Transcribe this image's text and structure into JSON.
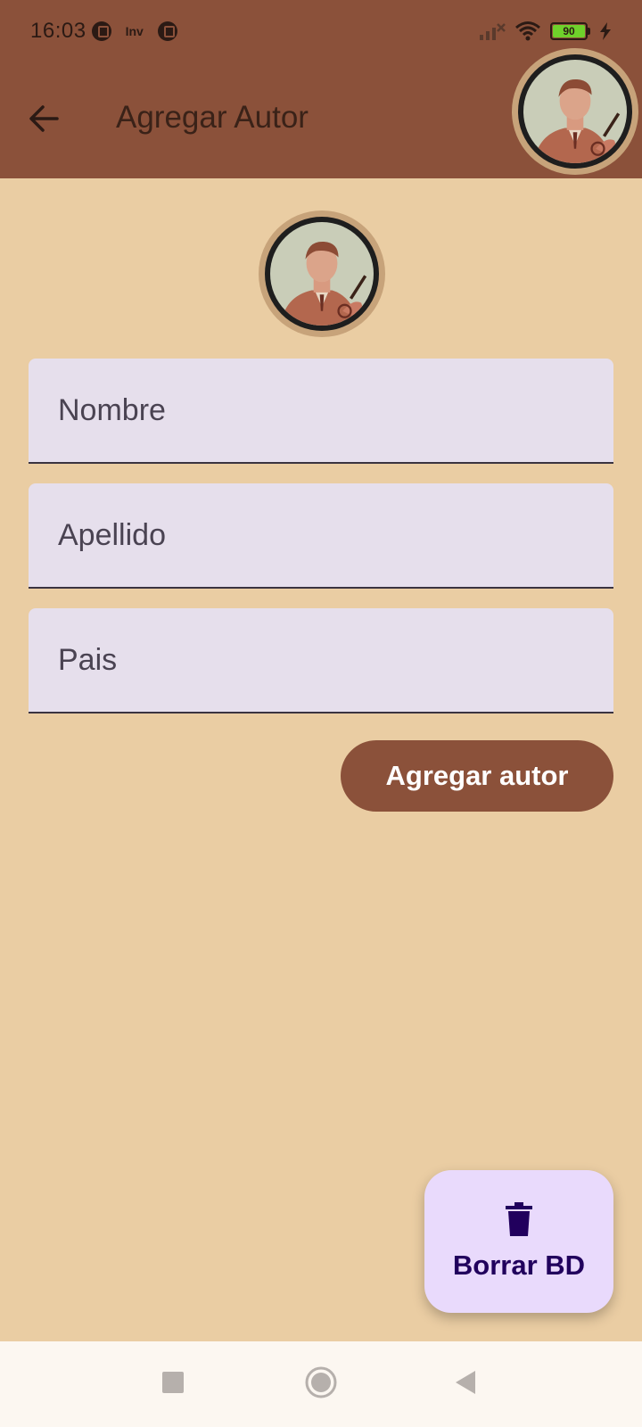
{
  "status_bar": {
    "time": "16:03",
    "app_text": "Inv",
    "battery_level": "90",
    "icons": [
      "app-notification-icon",
      "signal-icon",
      "wifi-icon",
      "battery-icon",
      "charging-bolt-icon"
    ]
  },
  "app_bar": {
    "title": "Agregar Autor",
    "back_icon": "arrow-back-icon",
    "avatar": "author-portrait-avatar"
  },
  "form": {
    "avatar": "author-portrait-avatar",
    "fields": {
      "nombre_placeholder": "Nombre",
      "apellido_placeholder": "Apellido",
      "pais_placeholder": "Pais"
    },
    "submit_label": "Agregar autor"
  },
  "fab": {
    "icon": "trash-icon",
    "label": "Borrar BD"
  },
  "nav_bar": {
    "icons": [
      "recent-apps-icon",
      "home-icon",
      "back-triangle-icon"
    ]
  },
  "colors": {
    "app_bar": "#8b513a",
    "background": "#eacda3",
    "field_background": "#e6dfec",
    "fab_background": "#e9dafc",
    "fab_text": "#21005d",
    "nav_background": "#fcf7f1"
  }
}
